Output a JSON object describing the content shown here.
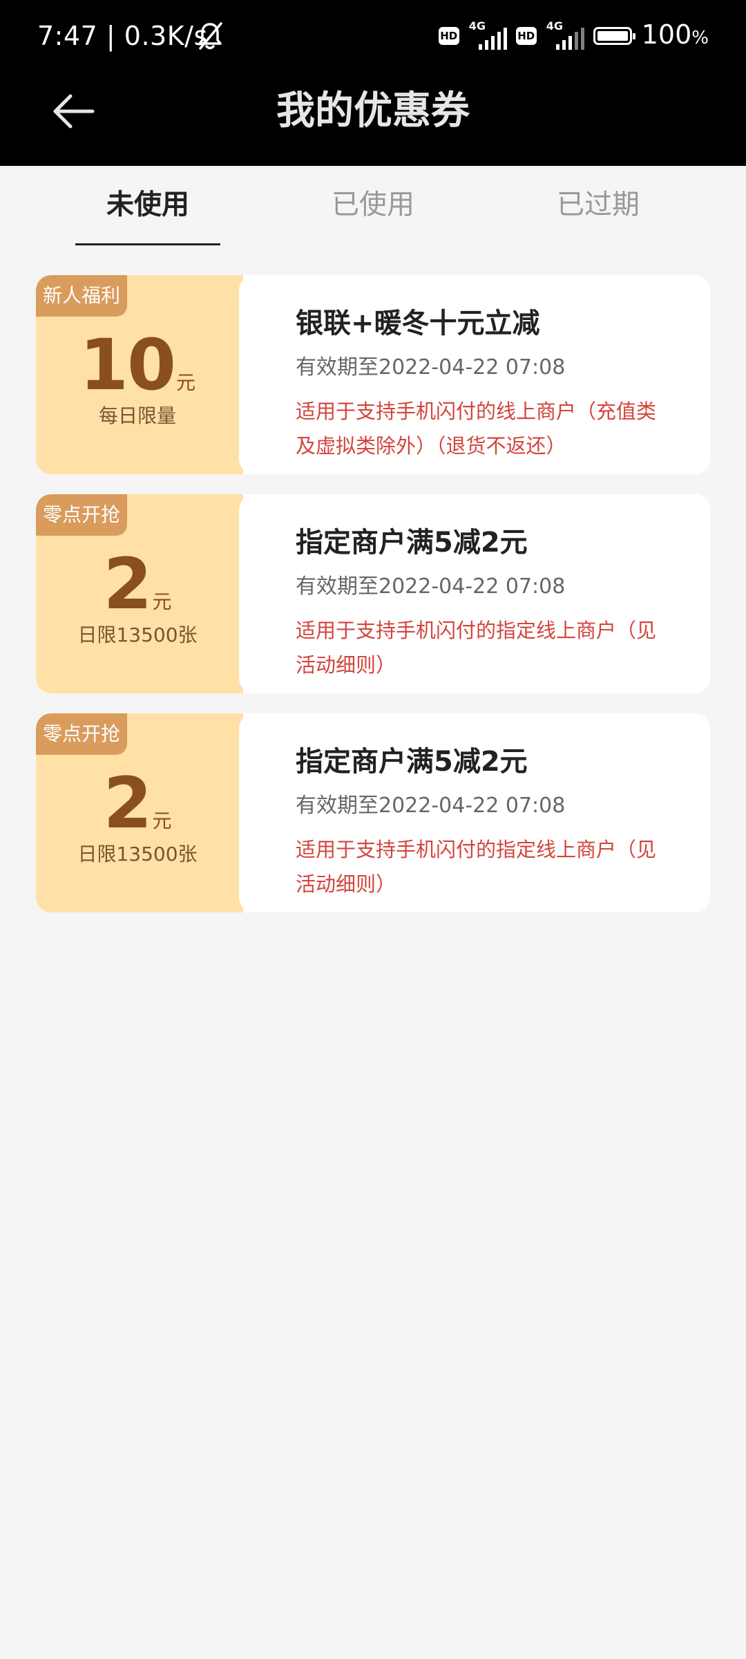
{
  "status_bar": {
    "time_speed": "7:47 | 0.3K/s",
    "hd_label": "HD",
    "network_label": "4G",
    "battery_percent": "100",
    "battery_unit": "%"
  },
  "header": {
    "title": "我的优惠券"
  },
  "tabs": [
    {
      "label": "未使用",
      "active": true
    },
    {
      "label": "已使用",
      "active": false
    },
    {
      "label": "已过期",
      "active": false
    }
  ],
  "coupons": [
    {
      "badge": "新人福利",
      "amount": "10",
      "unit": "元",
      "limit": "每日限量",
      "title": "银联+暖冬十元立减",
      "valid": "有效期至2022-04-22 07:08",
      "desc": "适用于支持手机闪付的线上商户（充值类及虚拟类除外）（退货不返还）"
    },
    {
      "badge": "零点开抢",
      "amount": "2",
      "unit": "元",
      "limit": "日限13500张",
      "title": "指定商户满5减2元",
      "valid": "有效期至2022-04-22 07:08",
      "desc": "适用于支持手机闪付的指定线上商户（见活动细则）"
    },
    {
      "badge": "零点开抢",
      "amount": "2",
      "unit": "元",
      "limit": "日限13500张",
      "title": "指定商户满5减2元",
      "valid": "有效期至2022-04-22 07:08",
      "desc": "适用于支持手机闪付的指定线上商户（见活动细则）"
    }
  ],
  "colors": {
    "coupon_left_bg": "#ffe0a6",
    "badge_bg": "#d99c5d",
    "amount_color": "#8a4f1f",
    "desc_color": "#d2453c"
  }
}
